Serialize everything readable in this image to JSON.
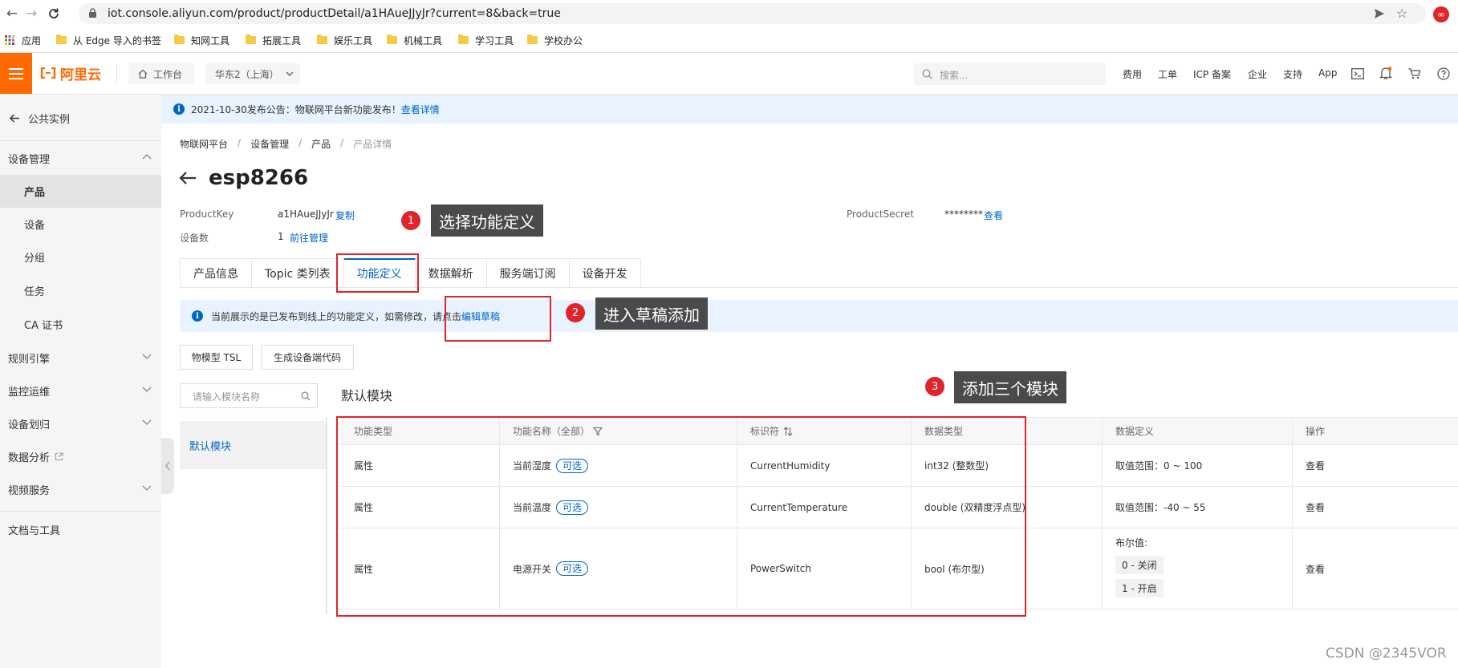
{
  "browser": {
    "url": "iot.console.aliyun.com/product/productDetail/a1HAueJJyJr?current=8&back=true",
    "bookmarks": [
      "应用",
      "从 Edge 导入的书签",
      "知网工具",
      "拓展工具",
      "娱乐工具",
      "机械工具",
      "学习工具",
      "学校办公"
    ]
  },
  "header": {
    "logo": "阿里云",
    "workbench": "工作台",
    "region": "华东2（上海）",
    "search_placeholder": "搜索...",
    "menu": [
      "费用",
      "工单",
      "ICP 备案",
      "企业",
      "支持",
      "App"
    ]
  },
  "sidebar": {
    "back": "公共实例",
    "section": "设备管理",
    "items": [
      "产品",
      "设备",
      "分组",
      "任务",
      "CA 证书"
    ],
    "groups": [
      "规则引擎",
      "监控运维",
      "设备划归",
      "数据分析",
      "视频服务"
    ],
    "footer": "文档与工具"
  },
  "notice": {
    "text": "2021-10-30发布公告：物联网平台新功能发布！",
    "link": "查看详情"
  },
  "breadcrumb": [
    "物联网平台",
    "设备管理",
    "产品",
    "产品详情"
  ],
  "product": {
    "name": "esp8266",
    "product_key_label": "ProductKey",
    "product_key": "a1HAueJJyJr",
    "copy": "复制",
    "device_count_label": "设备数",
    "device_count": "1",
    "manage_link": "前往管理",
    "secret_label": "ProductSecret",
    "secret": "********",
    "secret_view": "查看"
  },
  "tabs": [
    "产品信息",
    "Topic 类列表",
    "功能定义",
    "数据解析",
    "服务端订阅",
    "设备开发"
  ],
  "active_tab": "功能定义",
  "infobar": {
    "text": "当前展示的是已发布到线上的功能定义，如需修改，请点击",
    "link": "编辑草稿"
  },
  "buttons": {
    "tsl": "物模型 TSL",
    "gen_code": "生成设备端代码"
  },
  "module_search_placeholder": "请输入模块名称",
  "module_list": [
    "默认模块"
  ],
  "module_title": "默认模块",
  "table": {
    "headers": [
      "功能类型",
      "功能名称（全部）",
      "标识符",
      "数据类型",
      "数据定义",
      "操作"
    ],
    "rows": [
      {
        "type": "属性",
        "name": "当前湿度",
        "tag": "可选",
        "identifier": "CurrentHumidity",
        "datatype": "int32 (整数型)",
        "definition": "取值范围：0 ~ 100",
        "action": "查看"
      },
      {
        "type": "属性",
        "name": "当前温度",
        "tag": "可选",
        "identifier": "CurrentTemperature",
        "datatype": "double (双精度浮点型)",
        "definition": "取值范围：-40 ~ 55",
        "action": "查看"
      },
      {
        "type": "属性",
        "name": "电源开关",
        "tag": "可选",
        "identifier": "PowerSwitch",
        "datatype": "bool (布尔型)",
        "definition_title": "布尔值:",
        "enum": [
          "0 - 关闭",
          "1 - 开启"
        ],
        "action": "查看"
      }
    ]
  },
  "annotations": [
    {
      "num": "1",
      "text": "选择功能定义"
    },
    {
      "num": "2",
      "text": "进入草稿添加"
    },
    {
      "num": "3",
      "text": "添加三个模块"
    }
  ],
  "watermark": "CSDN @2345VOR",
  "colors": {
    "brand": "#ff6a00",
    "link": "#0064c8",
    "annotation": "#e0242a"
  }
}
